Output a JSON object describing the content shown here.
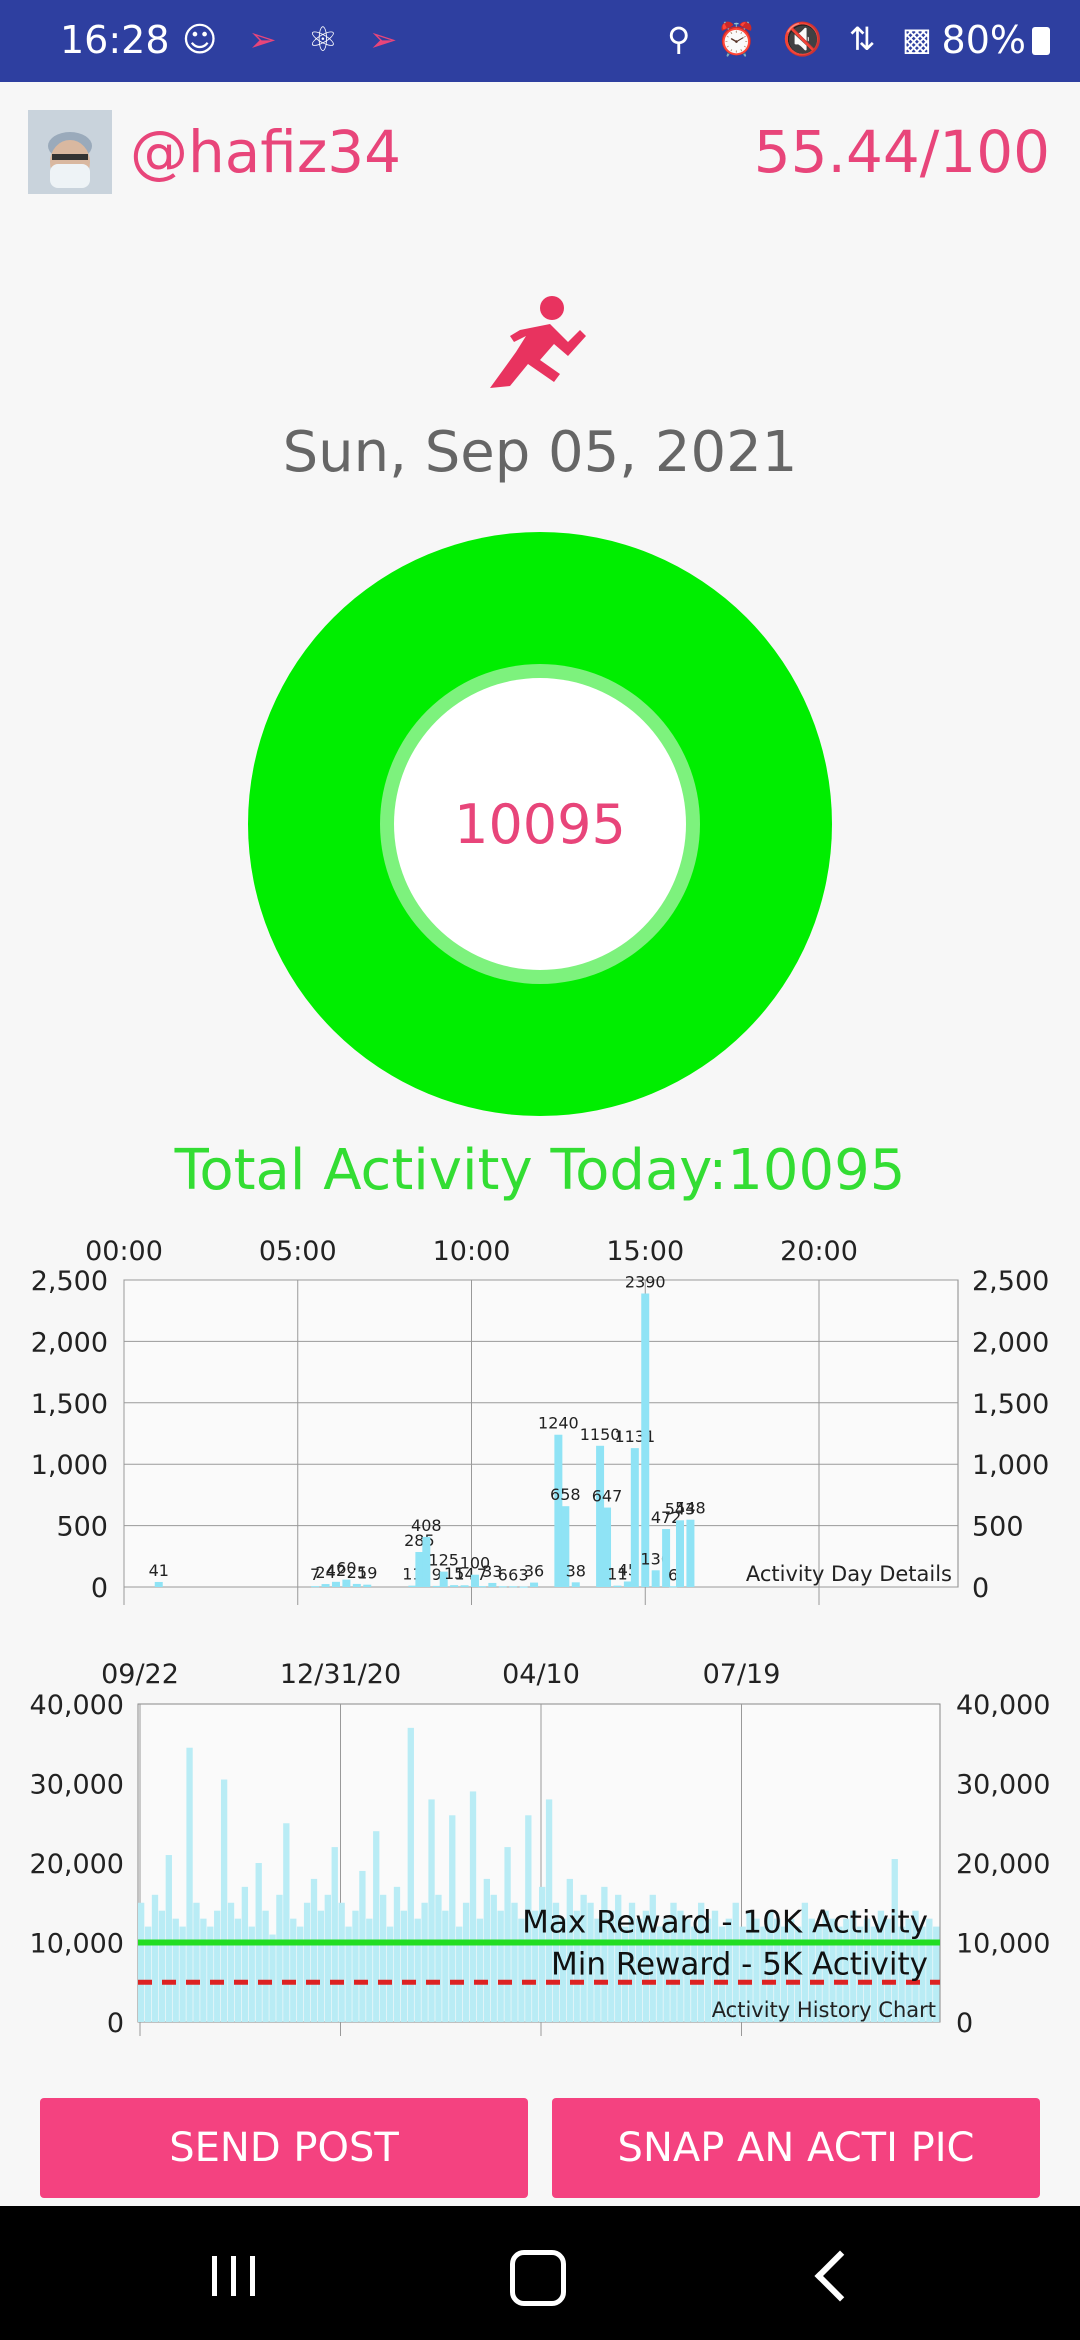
{
  "status_bar": {
    "time": "16:28",
    "battery": "80%"
  },
  "header": {
    "username": "@hafiz34",
    "score": "55.44/100"
  },
  "date": "Sun, Sep 05, 2021",
  "ring": {
    "value": "10095",
    "color": "#00ee00"
  },
  "total_label": "Total Activity Today:10095",
  "chart_data": [
    {
      "type": "bar",
      "title": "",
      "legend_label": "Activity Day Details",
      "x_ticks": [
        "00:00",
        "05:00",
        "10:00",
        "15:00",
        "20:00"
      ],
      "y_ticks": [
        "0",
        "500",
        "1,000",
        "1,500",
        "2,000",
        "2,500"
      ],
      "ylim": [
        0,
        2500
      ],
      "xlim_hours": [
        0,
        24
      ],
      "color": "#8fe3f5",
      "bars": [
        {
          "x": 1.0,
          "y": 41,
          "label": "41"
        },
        {
          "x": 5.5,
          "y": 7,
          "label": "7"
        },
        {
          "x": 5.8,
          "y": 24,
          "label": "24"
        },
        {
          "x": 6.1,
          "y": 42,
          "label": "42"
        },
        {
          "x": 6.4,
          "y": 60,
          "label": "60"
        },
        {
          "x": 6.7,
          "y": 25,
          "label": "25"
        },
        {
          "x": 7.0,
          "y": 19,
          "label": "19"
        },
        {
          "x": 8.3,
          "y": 11,
          "label": "11"
        },
        {
          "x": 8.5,
          "y": 285,
          "label": "285"
        },
        {
          "x": 8.7,
          "y": 408,
          "label": "408"
        },
        {
          "x": 9.0,
          "y": 9,
          "label": "9"
        },
        {
          "x": 9.2,
          "y": 125,
          "label": "125"
        },
        {
          "x": 9.5,
          "y": 15,
          "label": "15"
        },
        {
          "x": 9.8,
          "y": 14,
          "label": "14"
        },
        {
          "x": 10.1,
          "y": 100,
          "label": "100"
        },
        {
          "x": 10.3,
          "y": 7,
          "label": "7"
        },
        {
          "x": 10.6,
          "y": 33,
          "label": "33"
        },
        {
          "x": 10.9,
          "y": 6,
          "label": "6"
        },
        {
          "x": 11.2,
          "y": 6,
          "label": "6"
        },
        {
          "x": 11.5,
          "y": 3,
          "label": "3"
        },
        {
          "x": 11.8,
          "y": 36,
          "label": "36"
        },
        {
          "x": 12.5,
          "y": 1240,
          "label": "1240"
        },
        {
          "x": 12.7,
          "y": 658,
          "label": "658"
        },
        {
          "x": 13.0,
          "y": 38,
          "label": "38"
        },
        {
          "x": 13.7,
          "y": 1150,
          "label": "1150"
        },
        {
          "x": 13.9,
          "y": 647,
          "label": "647"
        },
        {
          "x": 14.2,
          "y": 11,
          "label": "11"
        },
        {
          "x": 14.5,
          "y": 45,
          "label": "45"
        },
        {
          "x": 14.7,
          "y": 1131,
          "label": "1131"
        },
        {
          "x": 15.0,
          "y": 2390,
          "label": "2390"
        },
        {
          "x": 15.3,
          "y": 136,
          "label": "136"
        },
        {
          "x": 15.6,
          "y": 472,
          "label": "472"
        },
        {
          "x": 15.8,
          "y": 6,
          "label": "6"
        },
        {
          "x": 16.0,
          "y": 543,
          "label": "543"
        },
        {
          "x": 16.3,
          "y": 548,
          "label": "548"
        }
      ]
    },
    {
      "type": "bar",
      "title": "",
      "legend_label": "Activity History Chart",
      "x_ticks": [
        "09/22",
        "12/31/20",
        "04/10",
        "07/19"
      ],
      "y_ticks": [
        "0",
        "10,000",
        "20,000",
        "30,000",
        "40,000"
      ],
      "ylim": [
        0,
        40000
      ],
      "color": "#b9ecf5",
      "reference_lines": [
        {
          "label": "Max Reward - 10K Activity",
          "value": 10000,
          "color": "#22dd22",
          "style": "solid"
        },
        {
          "label": "Min Reward - 5K Activity",
          "value": 5000,
          "color": "#dd2222",
          "style": "dashed"
        }
      ],
      "values": [
        15000,
        12000,
        16000,
        14000,
        21000,
        13000,
        12000,
        34500,
        15000,
        13000,
        12000,
        14000,
        30500,
        15000,
        13000,
        17000,
        12000,
        20000,
        14000,
        11000,
        16000,
        25000,
        13000,
        12000,
        15000,
        18000,
        14000,
        16000,
        22000,
        15000,
        12000,
        14000,
        19000,
        13000,
        24000,
        16000,
        12000,
        17000,
        14000,
        37000,
        13000,
        15000,
        28000,
        16000,
        14000,
        26000,
        12000,
        15000,
        29000,
        13000,
        18000,
        16000,
        14000,
        22000,
        15000,
        13000,
        26000,
        14000,
        17000,
        28000,
        15000,
        13000,
        18000,
        14000,
        16000,
        15000,
        13000,
        17000,
        14000,
        16000,
        12000,
        15000,
        13000,
        14000,
        16000,
        12000,
        13000,
        15000,
        14000,
        13000,
        12000,
        15000,
        13000,
        14000,
        12000,
        13000,
        15000,
        12000,
        14000,
        13000,
        12000,
        14000,
        13000,
        12000,
        13000,
        12000,
        15000,
        13000,
        12000,
        14000,
        13000,
        12000,
        13000,
        14000,
        12000,
        13000,
        12000,
        14000,
        13000,
        20500,
        12000,
        13000,
        14000,
        12000,
        13000,
        12000
      ]
    }
  ],
  "buttons": {
    "send_post": "SEND POST",
    "snap": "SNAP AN ACTI PIC"
  }
}
